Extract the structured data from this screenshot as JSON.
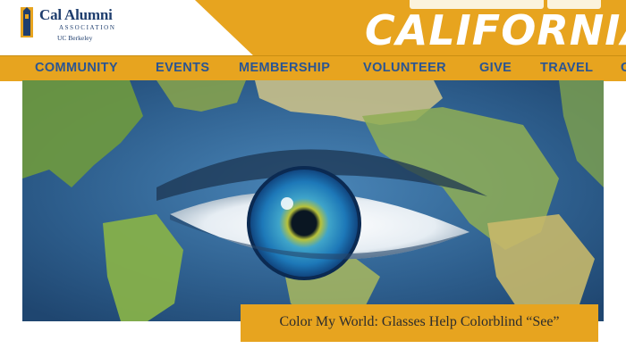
{
  "header": {
    "logo": {
      "title": "Cal Alumni",
      "subtitle": "ASSOCIATION",
      "school": "UC Berkeley"
    },
    "wordmark": "CALIFORNIA"
  },
  "nav": {
    "items": [
      {
        "label": "COMMUNITY"
      },
      {
        "label": "EVENTS"
      },
      {
        "label": "MEMBERSHIP"
      },
      {
        "label": "VOLUNTEER"
      },
      {
        "label": "GIVE"
      },
      {
        "label": "TRAVEL"
      },
      {
        "label": "C"
      }
    ]
  },
  "hero": {
    "caption": "Color My World: Glasses Help Colorblind “See”"
  },
  "colors": {
    "gold": "#e7a41f",
    "navy": "#1f3e6e",
    "nav_text": "#2a5592"
  }
}
